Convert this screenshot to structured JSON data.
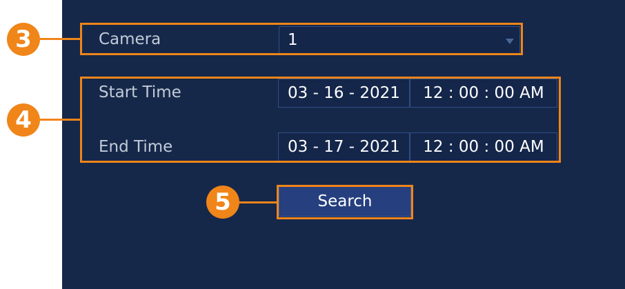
{
  "form": {
    "camera_label": "Camera",
    "camera_value": "1",
    "start_time_label": "Start Time",
    "start_date": "03 - 16 - 2021",
    "start_time": "12 : 00 : 00 AM",
    "end_time_label": "End Time",
    "end_date": "03 - 17 - 2021",
    "end_time": "12 : 00 : 00 AM",
    "search_label": "Search"
  },
  "callouts": {
    "camera": "3",
    "time_range": "4",
    "search": "5"
  },
  "icons": {
    "dropdown": "chevron-down-icon"
  },
  "colors": {
    "background": "#16284a",
    "accent": "#f08519",
    "field_border": "#2f4f86",
    "button": "#253f7f"
  }
}
